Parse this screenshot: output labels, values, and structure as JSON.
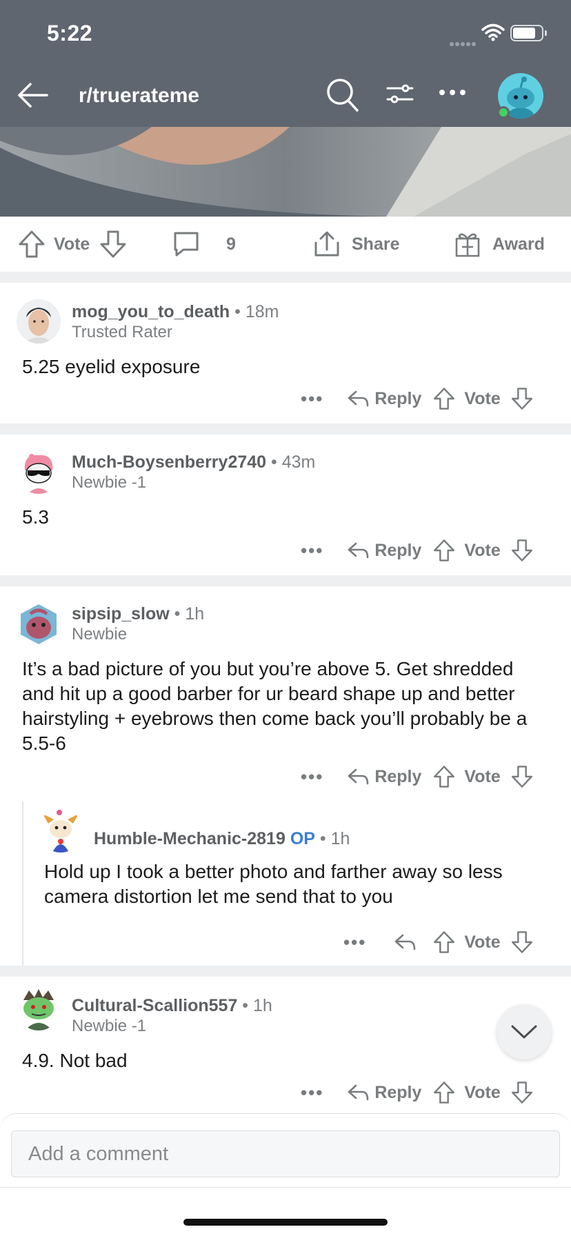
{
  "status_bar": {
    "time": "5:22"
  },
  "header": {
    "subreddit": "r/truerateme"
  },
  "post_actions": {
    "vote_label": "Vote",
    "comment_count": "9",
    "share_label": "Share",
    "award_label": "Award"
  },
  "comments": [
    {
      "username": "mog_you_to_death",
      "time": "18m",
      "flair": "Trusted Rater",
      "body": "5.25 eyelid exposure",
      "reply_label": "Reply",
      "vote_label": "Vote"
    },
    {
      "username": "Much-Boysenberry2740",
      "time": "43m",
      "flair": "Newbie -1",
      "body": "5.3",
      "reply_label": "Reply",
      "vote_label": "Vote"
    },
    {
      "username": "sipsip_slow",
      "time": "1h",
      "flair": "Newbie",
      "body": "It’s a bad picture of you but you’re above 5. Get shredded and hit up a good barber for ur beard shape up and better hairstyling + eyebrows then come back you’ll probably be a 5.5-6",
      "reply_label": "Reply",
      "vote_label": "Vote"
    },
    {
      "username": "Humble-Mechanic-2819",
      "op_badge": "OP",
      "time": "1h",
      "body": "Hold up I took a better photo and farther away so less camera distortion let me send that to you",
      "vote_label": "Vote"
    },
    {
      "username": "Cultural-Scallion557",
      "time": "1h",
      "flair": "Newbie -1",
      "body": "4.9. Not bad",
      "reply_label": "Reply",
      "vote_label": "Vote"
    }
  ],
  "composer": {
    "placeholder": "Add a comment"
  },
  "colors": {
    "header_bg": "#5f6670",
    "op_badge": "#3a7ed2",
    "muted": "#787c7e",
    "divider": "#edeff1"
  }
}
